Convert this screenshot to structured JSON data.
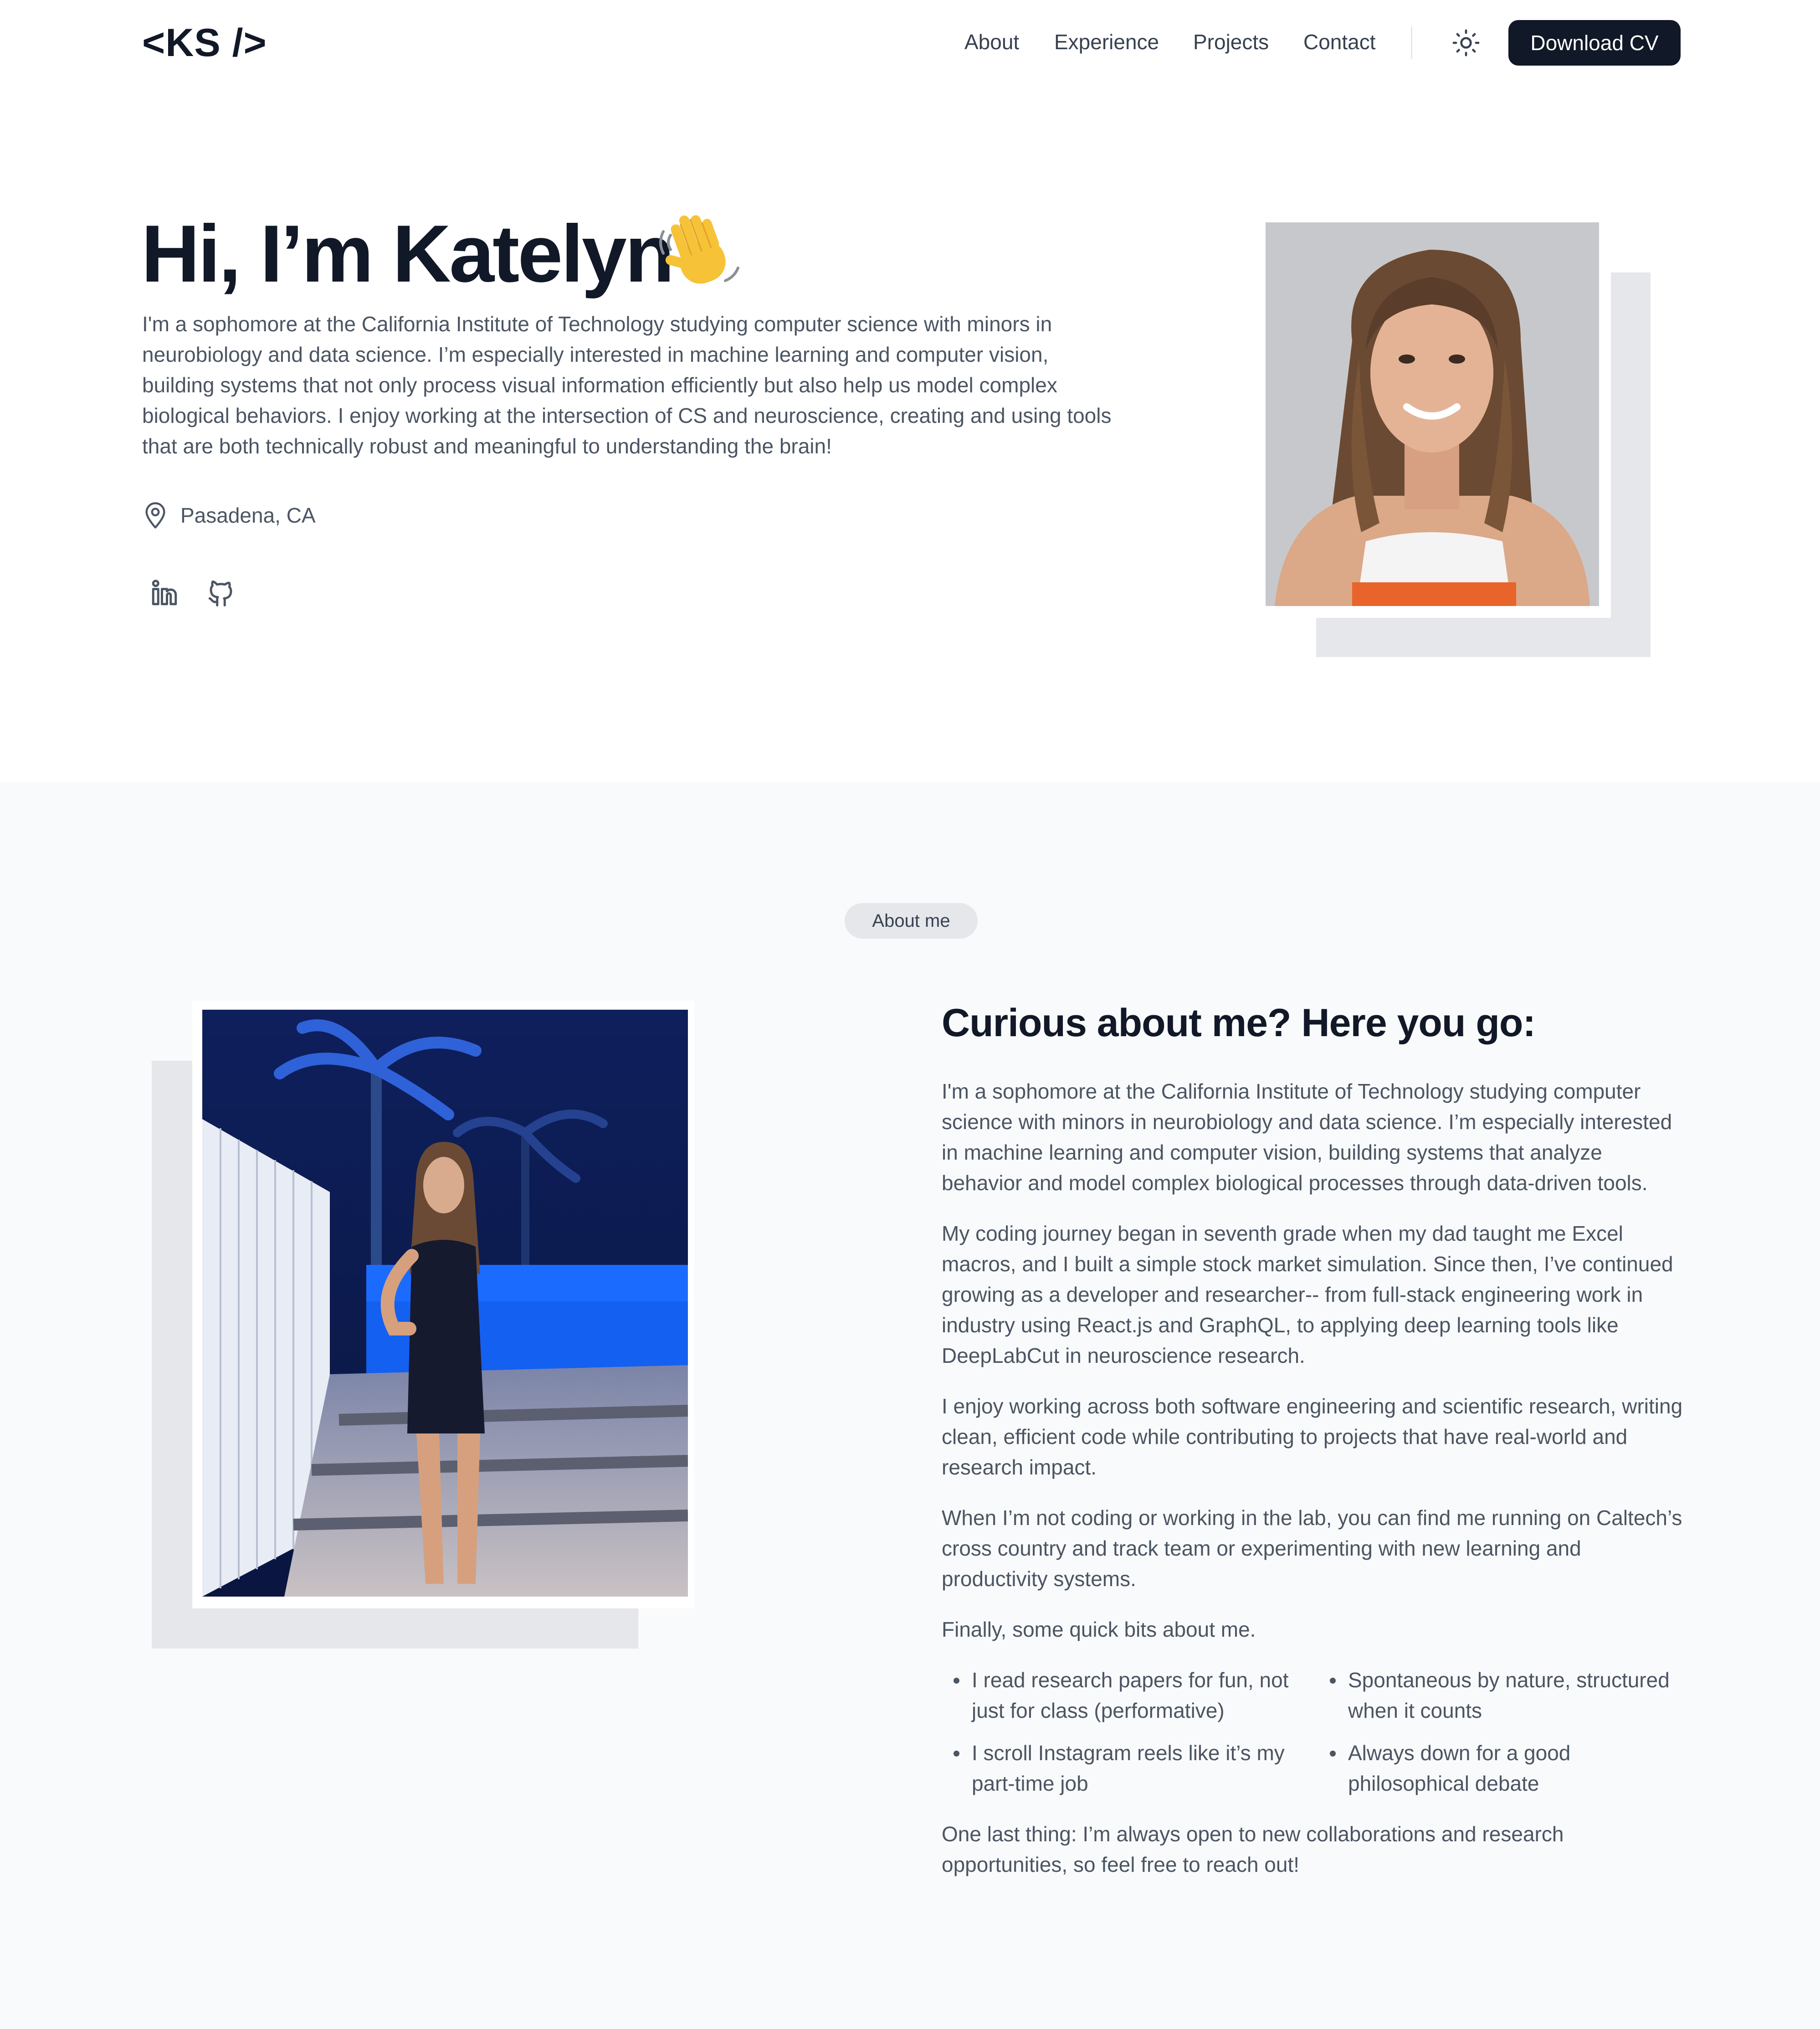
{
  "header": {
    "logo": "<KS />",
    "nav": [
      "About",
      "Experience",
      "Projects",
      "Contact"
    ],
    "theme_icon": "sun-icon",
    "cv_button": "Download CV"
  },
  "hero": {
    "title": "Hi, I’m Katelyn",
    "wave_icon": "waving-hand-emoji",
    "intro": "I'm a sophomore at the California Institute of Technology studying computer science with minors in neurobiology and data science. I’m especially interested in machine learning and computer vision, building systems that not only process visual information efficiently but also help us model complex biological behaviors. I enjoy working at the intersection of CS and neuroscience, creating and using tools that are both technically robust and meaningful to understanding the brain!",
    "location_icon": "map-pin-icon",
    "location": "Pasadena, CA",
    "socials": [
      "linkedin-icon",
      "github-icon"
    ]
  },
  "about": {
    "pill": "About me",
    "heading": "Curious about me? Here you go:",
    "paragraphs": [
      "I'm a sophomore at the California Institute of Technology studying computer science with minors in neurobiology and data science. I’m especially interested in machine learning and computer vision, building systems that analyze behavior and model complex biological processes through data-driven tools.",
      "My coding journey began in seventh grade when my dad taught me Excel macros, and I built a simple stock market simulation. Since then, I’ve continued growing as a developer and researcher--  from full-stack engineering work in industry using React.js and GraphQL, to applying deep learning tools like DeepLabCut in neuroscience research.",
      "I enjoy working across both software engineering and scientific research, writing clean, efficient code while contributing to projects that have real-world and research impact.",
      "When I’m not coding or working in the lab, you can find me running on Caltech’s cross country and track team or experimenting with new learning and productivity systems.",
      "Finally, some quick bits about me."
    ],
    "bullets": [
      "I read research papers for fun, not just for class (performative)",
      "Spontaneous by nature, structured when it counts",
      "I scroll Instagram reels like it’s my part-time job",
      "Always down for a good philosophical debate"
    ],
    "closing": "One last thing: I’m always open to new collaborations and research opportunities, so feel free to reach out!"
  },
  "colors": {
    "text_dark": "#111827",
    "text_body": "#4b5563",
    "button_bg": "#111827",
    "section_bg": "#f9fafb",
    "accent_gray": "#e5e7eb"
  }
}
